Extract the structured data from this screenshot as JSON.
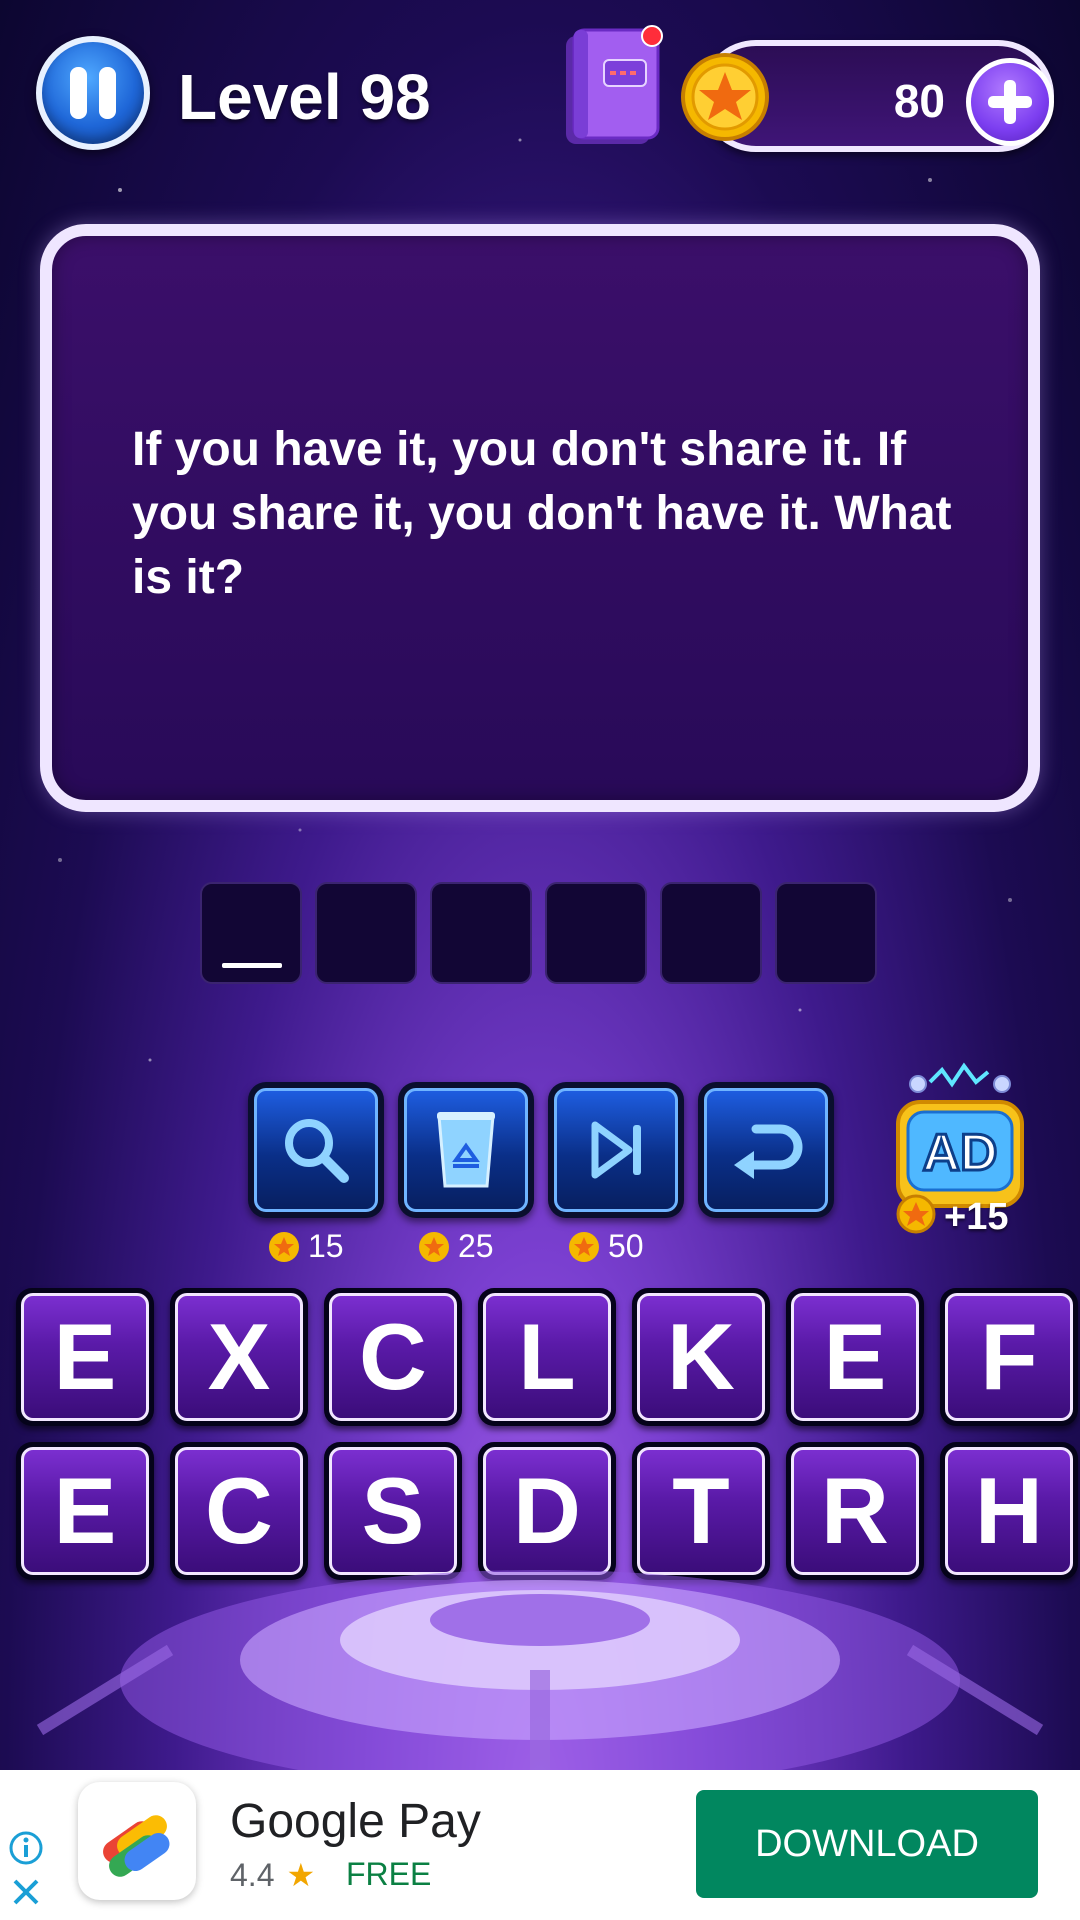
{
  "header": {
    "level_title": "Level 98",
    "coin_value": "80"
  },
  "question": {
    "text": "If you have it, you don't share it. If you share it, you don't have it. What is it?"
  },
  "answer": {
    "slots": 6
  },
  "tools": {
    "costs": [
      "15",
      "25",
      "50"
    ],
    "ad_reward": "+15",
    "ad_label": "AD"
  },
  "letters": {
    "row1": [
      "E",
      "X",
      "C",
      "L",
      "K",
      "E",
      "F"
    ],
    "row2": [
      "E",
      "C",
      "S",
      "D",
      "T",
      "R",
      "H"
    ]
  },
  "ad_banner": {
    "app_name": "Google Pay",
    "rating": "4.4",
    "price": "FREE",
    "cta": "DOWNLOAD"
  },
  "colors": {
    "accent_purple": "#7b2fd0",
    "tool_blue": "#1e5de0",
    "download_green": "#01875f",
    "coin_gold": "#f5b800"
  }
}
